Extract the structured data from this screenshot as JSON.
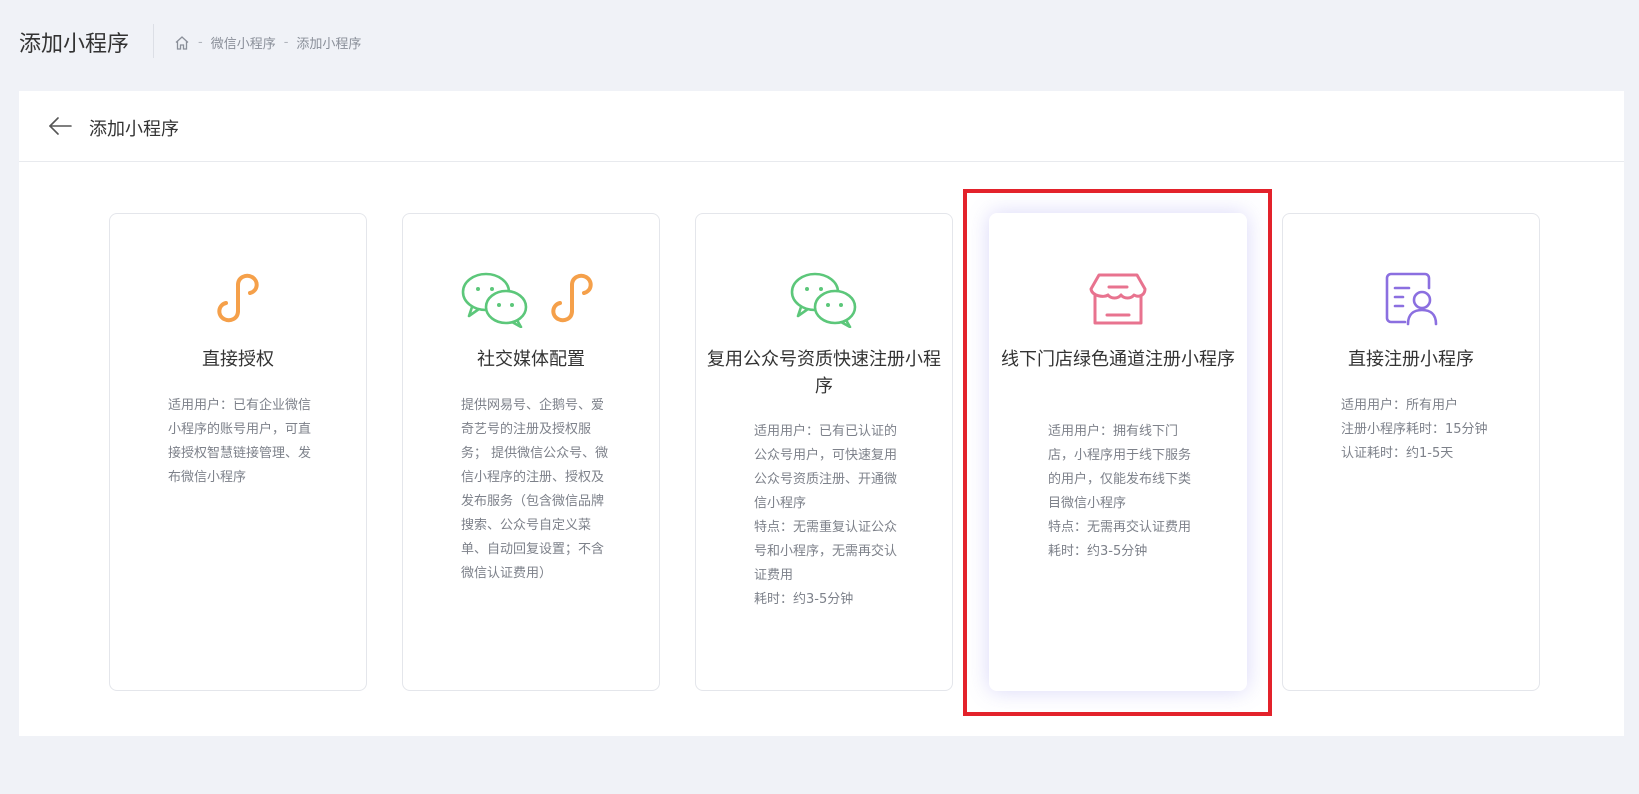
{
  "header": {
    "title": "添加小程序",
    "breadcrumb": {
      "items": [
        "微信小程序",
        "添加小程序"
      ],
      "separator": "-"
    }
  },
  "panel": {
    "title": "添加小程序"
  },
  "cards": [
    {
      "title": "直接授权",
      "description": "适用用户：已有企业微信小程序的账号用户，可直接授权智慧链接管理、发布微信小程序",
      "icons": [
        "mini-program-icon"
      ],
      "selected": false
    },
    {
      "title": "社交媒体配置",
      "description": "提供网易号、企鹅号、爱奇艺号的注册及授权服务； 提供微信公众号、微信小程序的注册、授权及发布服务（包含微信品牌搜索、公众号自定义菜单、自动回复设置；不含微信认证费用）",
      "icons": [
        "wechat-icon",
        "mini-program-icon"
      ],
      "selected": false
    },
    {
      "title": "复用公众号资质快速注册小程序",
      "description": "适用用户：已有已认证的公众号用户，可快速复用公众号资质注册、开通微信小程序\n特点：无需重复认证公众号和小程序，无需再交认证费用\n耗时：约3-5分钟",
      "icons": [
        "wechat-icon"
      ],
      "selected": false
    },
    {
      "title": "线下门店绿色通道注册小程序",
      "description": "适用用户：拥有线下门店，小程序用于线下服务的用户，仅能发布线下类目微信小程序\n特点：无需再交认证费用\n耗时：约3-5分钟",
      "icons": [
        "store-icon"
      ],
      "selected": true
    },
    {
      "title": "直接注册小程序",
      "description": "适用用户：所有用户\n注册小程序耗时：15分钟\n认证耗时：约1-5天",
      "icons": [
        "id-card-icon"
      ],
      "selected": false
    }
  ],
  "colors": {
    "mini_program": "#f5a04a",
    "wechat": "#5cc77a",
    "store": "#e8738f",
    "id_card": "#8b6fe0",
    "highlight": "#e3222b",
    "page_bg": "#f0f2f7"
  }
}
